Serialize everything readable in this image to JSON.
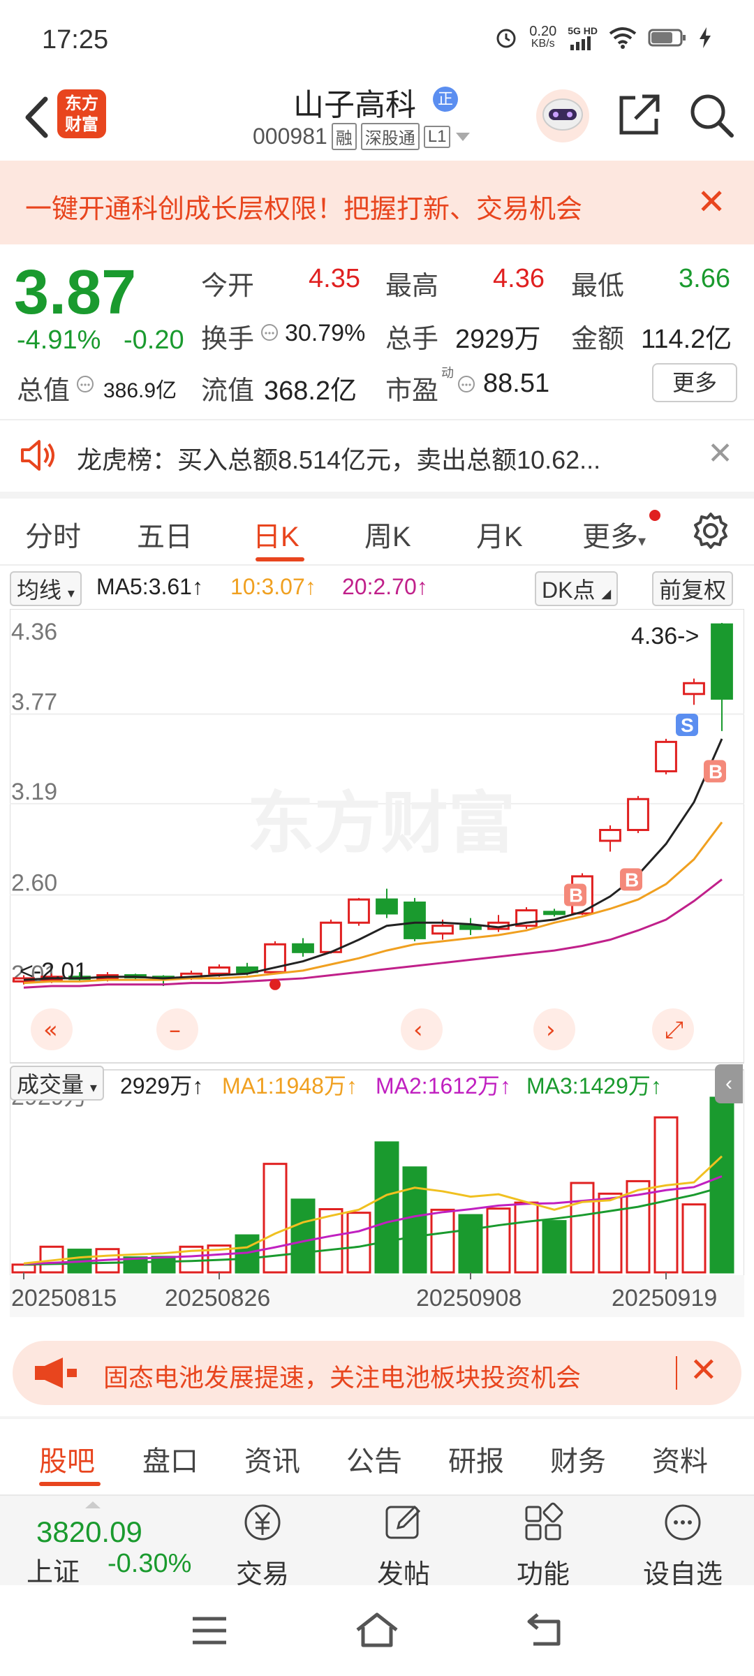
{
  "status_bar": {
    "time": "17:25",
    "net_speed": "0.20",
    "net_unit": "KB/s",
    "net_type": "5G HD"
  },
  "header": {
    "logo_line1": "东方",
    "logo_line2": "财富",
    "stock_name": "山子高科",
    "badge": "正",
    "stock_code": "000981",
    "tags": [
      "融",
      "深股通",
      "L1"
    ]
  },
  "banner": {
    "text": "一键开通科创成长层权限！把握打新、交易机会",
    "close": "✕"
  },
  "quote": {
    "price": "3.87",
    "change_pct": "-4.91%",
    "change_amt": "-0.20",
    "open_label": "今开",
    "open": "4.35",
    "high_label": "最高",
    "high": "4.36",
    "low_label": "最低",
    "low": "3.66",
    "turnover_label": "换手",
    "turnover": "30.79%",
    "volume_label": "总手",
    "volume": "2929万",
    "amount_label": "金额",
    "amount": "114.2亿",
    "mktcap_label": "总值",
    "mktcap": "386.9亿",
    "float_label": "流值",
    "float": "368.2亿",
    "pe_label": "市盈",
    "pe_sup": "动",
    "pe": "88.51",
    "more": "更多"
  },
  "dragon": {
    "text": "龙虎榜：买入总额8.514亿元，卖出总额10.62..."
  },
  "tabs": [
    "分时",
    "五日",
    "日K",
    "周K",
    "月K",
    "更多"
  ],
  "ma_bar": {
    "selector": "均线",
    "ma5": "MA5:3.61",
    "ma10": "10:3.07",
    "ma20": "20:2.70",
    "dk": "DK点",
    "adjust": "前复权"
  },
  "colors": {
    "up": "#e02020",
    "down": "#1a9a2e",
    "accent": "#e8451e",
    "ma5": "#222222",
    "ma10": "#f0a020",
    "ma20": "#c0208a"
  },
  "chart_data": {
    "type": "candlestick",
    "price_ticks": [
      "4.36",
      "3.77",
      "3.19",
      "2.60",
      "2.01"
    ],
    "price_range": [
      2.01,
      4.36
    ],
    "max_label": "4.36->",
    "min_label": "<-2.01",
    "watermark": "东方财富",
    "candles": [
      {
        "o": 2.04,
        "c": 2.06,
        "h": 2.08,
        "l": 2.02
      },
      {
        "o": 2.05,
        "c": 2.07,
        "h": 2.09,
        "l": 2.03
      },
      {
        "o": 2.07,
        "c": 2.06,
        "h": 2.1,
        "l": 2.04
      },
      {
        "o": 2.06,
        "c": 2.08,
        "h": 2.1,
        "l": 2.04
      },
      {
        "o": 2.08,
        "c": 2.07,
        "h": 2.09,
        "l": 2.05
      },
      {
        "o": 2.07,
        "c": 2.06,
        "h": 2.08,
        "l": 2.01
      },
      {
        "o": 2.06,
        "c": 2.09,
        "h": 2.11,
        "l": 2.05
      },
      {
        "o": 2.09,
        "c": 2.13,
        "h": 2.15,
        "l": 2.07
      },
      {
        "o": 2.13,
        "c": 2.1,
        "h": 2.16,
        "l": 2.08
      },
      {
        "o": 2.1,
        "c": 2.28,
        "h": 2.3,
        "l": 2.09
      },
      {
        "o": 2.28,
        "c": 2.23,
        "h": 2.32,
        "l": 2.2
      },
      {
        "o": 2.23,
        "c": 2.42,
        "h": 2.44,
        "l": 2.22
      },
      {
        "o": 2.42,
        "c": 2.57,
        "h": 2.58,
        "l": 2.4
      },
      {
        "o": 2.57,
        "c": 2.48,
        "h": 2.64,
        "l": 2.45
      },
      {
        "o": 2.55,
        "c": 2.32,
        "h": 2.58,
        "l": 2.3
      },
      {
        "o": 2.35,
        "c": 2.4,
        "h": 2.44,
        "l": 2.31
      },
      {
        "o": 2.4,
        "c": 2.38,
        "h": 2.45,
        "l": 2.34
      },
      {
        "o": 2.38,
        "c": 2.42,
        "h": 2.47,
        "l": 2.36
      },
      {
        "o": 2.4,
        "c": 2.5,
        "h": 2.52,
        "l": 2.38
      },
      {
        "o": 2.49,
        "c": 2.48,
        "h": 2.51,
        "l": 2.46
      },
      {
        "o": 2.48,
        "c": 2.72,
        "h": 2.74,
        "l": 2.47
      },
      {
        "o": 2.95,
        "c": 3.02,
        "h": 3.05,
        "l": 2.88
      },
      {
        "o": 3.02,
        "c": 3.22,
        "h": 3.24,
        "l": 3.0
      },
      {
        "o": 3.4,
        "c": 3.59,
        "h": 3.61,
        "l": 3.38
      },
      {
        "o": 3.9,
        "c": 3.97,
        "h": 4.0,
        "l": 3.83
      },
      {
        "o": 4.35,
        "c": 3.87,
        "h": 4.36,
        "l": 3.66
      }
    ],
    "ma5": [
      2.05,
      2.06,
      2.06,
      2.07,
      2.07,
      2.06,
      2.07,
      2.08,
      2.09,
      2.13,
      2.17,
      2.23,
      2.31,
      2.4,
      2.42,
      2.42,
      2.41,
      2.39,
      2.42,
      2.44,
      2.49,
      2.59,
      2.73,
      2.93,
      3.2,
      3.61
    ],
    "ma10": [
      2.03,
      2.04,
      2.04,
      2.05,
      2.05,
      2.05,
      2.06,
      2.06,
      2.07,
      2.09,
      2.11,
      2.15,
      2.19,
      2.24,
      2.28,
      2.3,
      2.32,
      2.34,
      2.37,
      2.42,
      2.46,
      2.51,
      2.57,
      2.67,
      2.83,
      3.07
    ],
    "ma20": [
      2.0,
      2.01,
      2.01,
      2.02,
      2.02,
      2.02,
      2.03,
      2.03,
      2.04,
      2.05,
      2.06,
      2.08,
      2.1,
      2.12,
      2.14,
      2.16,
      2.18,
      2.2,
      2.22,
      2.24,
      2.27,
      2.31,
      2.37,
      2.44,
      2.56,
      2.7
    ],
    "signals": [
      {
        "i": 20,
        "t": "B",
        "p": 2.6
      },
      {
        "i": 22,
        "t": "B",
        "p": 2.7
      },
      {
        "i": 24,
        "t": "S",
        "p": 3.7
      },
      {
        "i": 25,
        "t": "B",
        "p": 3.4
      }
    ],
    "volume_label": "成交量",
    "volume_total": "2929万",
    "vol_ma1": "MA1:1948万",
    "vol_ma2": "MA2:1612万",
    "vol_ma3": "MA3:1429万",
    "volume_max_label": "2929万",
    "volumes": [
      130,
      430,
      380,
      390,
      250,
      260,
      430,
      450,
      620,
      1820,
      1220,
      1060,
      1000,
      2180,
      1760,
      1050,
      960,
      1070,
      1170,
      860,
      1500,
      1320,
      1530,
      2600,
      1140,
      2929
    ],
    "vol_ma_a": [
      150,
      200,
      250,
      280,
      300,
      320,
      360,
      380,
      420,
      650,
      840,
      950,
      1050,
      1300,
      1420,
      1360,
      1270,
      1310,
      1180,
      1050,
      1180,
      1210,
      1380,
      1460,
      1510,
      1948
    ],
    "vol_ma_b": [
      140,
      160,
      180,
      210,
      230,
      250,
      270,
      300,
      330,
      420,
      520,
      610,
      690,
      840,
      940,
      1010,
      1060,
      1120,
      1150,
      1160,
      1200,
      1240,
      1300,
      1380,
      1430,
      1612
    ],
    "vol_ma_c": [
      130,
      140,
      150,
      160,
      170,
      180,
      190,
      210,
      230,
      280,
      330,
      380,
      430,
      520,
      600,
      660,
      720,
      790,
      850,
      900,
      960,
      1030,
      1100,
      1200,
      1300,
      1429
    ],
    "dates": [
      {
        "i": 0,
        "label": "20250815"
      },
      {
        "i": 7,
        "label": "20250826"
      },
      {
        "i": 16,
        "label": "20250908"
      },
      {
        "i": 23,
        "label": "20250919"
      }
    ]
  },
  "notice": {
    "text": "固态电池发展提速，关注电池板块投资机会",
    "close": "✕"
  },
  "subtabs": [
    "股吧",
    "盘口",
    "资讯",
    "公告",
    "研报",
    "财务",
    "资料"
  ],
  "bottom": {
    "index_value": "3820.09",
    "index_name": "上证",
    "index_change": "-0.30%",
    "nav": [
      "交易",
      "发帖",
      "功能",
      "设自选"
    ]
  }
}
